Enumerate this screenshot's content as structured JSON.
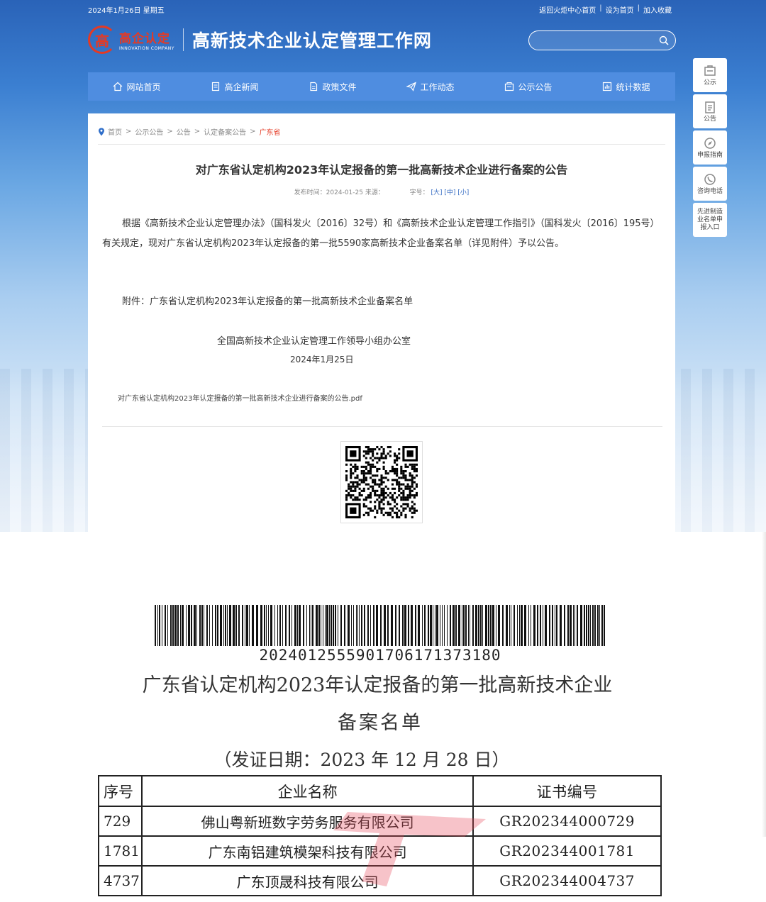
{
  "topbar": {
    "date": "2024年1月26日 星期五",
    "link_home": "返回火炬中心首页",
    "sep": "|",
    "link_set_home": "设为首页",
    "link_favorite": "加入收藏"
  },
  "logo": {
    "name_cn": "高企认定",
    "name_en": "INNOVATION COMPANY"
  },
  "site_title": "高新技术企业认定管理工作网",
  "search": {
    "placeholder": ""
  },
  "nav": [
    {
      "label": "网站首页",
      "icon": "home-icon"
    },
    {
      "label": "高企新闻",
      "icon": "document-icon"
    },
    {
      "label": "政策文件",
      "icon": "file-icon"
    },
    {
      "label": "工作动态",
      "icon": "send-icon"
    },
    {
      "label": "公示公告",
      "icon": "notice-icon"
    },
    {
      "label": "统计数据",
      "icon": "stats-icon"
    }
  ],
  "breadcrumb": [
    "首页",
    "公示公告",
    "公告",
    "认定备案公告",
    "广东省"
  ],
  "breadcrumb_sep": ">",
  "article": {
    "title": "对广东省认定机构2023年认定报备的第一批高新技术企业进行备案的公告",
    "meta_prefix": "发布时间：2024-01-25 来源：",
    "font_label": "字号：",
    "font_large": "[大]",
    "font_medium": "[中]",
    "font_small": "[小]",
    "body": "根据《高新技术企业认定管理办法》（国科发火〔2016〕32号）和《高新技术企业认定管理工作指引》（国科发火〔2016〕195号）有关规定，现对广东省认定机构2023年认定报备的第一批5590家高新技术企业备案名单（详见附件）予以公告。",
    "attachment": "附件：广东省认定机构2023年认定报备的第一批高新技术企业备案名单",
    "signature": "全国高新技术企业认定管理工作领导小组办公室",
    "sign_date": "2024年1月25日",
    "pdf_link": "对广东省认定机构2023年认定报备的第一批高新技术企业进行备案的公告.pdf"
  },
  "side_tools": [
    {
      "label": "公示",
      "icon": "notice-board-icon"
    },
    {
      "label": "公告",
      "icon": "clipboard-icon"
    },
    {
      "label": "申报指南",
      "icon": "compass-icon"
    },
    {
      "label": "咨询电话",
      "icon": "phone-icon"
    },
    {
      "label": "先进制造业名单申报入口",
      "icon": "entry-icon"
    }
  ],
  "document": {
    "barcode_number": "20240125559017061713731​80",
    "title_line1": "广东省认定机构2023年认定报备的第一批高新技术企业",
    "title_line2": "备案名单",
    "issue_date": "（发证日期：2023 年 12 月 28 日）",
    "columns": [
      "序号",
      "企业名称",
      "证书编号"
    ],
    "rows": [
      [
        "729",
        "佛山粤新班数字劳务服务有限公司",
        "GR202344000729"
      ],
      [
        "1781",
        "广东南铝建筑模架科技有限公司",
        "GR202344001781"
      ],
      [
        "4737",
        "广东顶晟科技有限公司",
        "GR202344004737"
      ]
    ]
  },
  "colors": {
    "nav_bg": "#4f8de0",
    "accent_red": "#e43a24",
    "link_blue": "#3a6fc4"
  }
}
